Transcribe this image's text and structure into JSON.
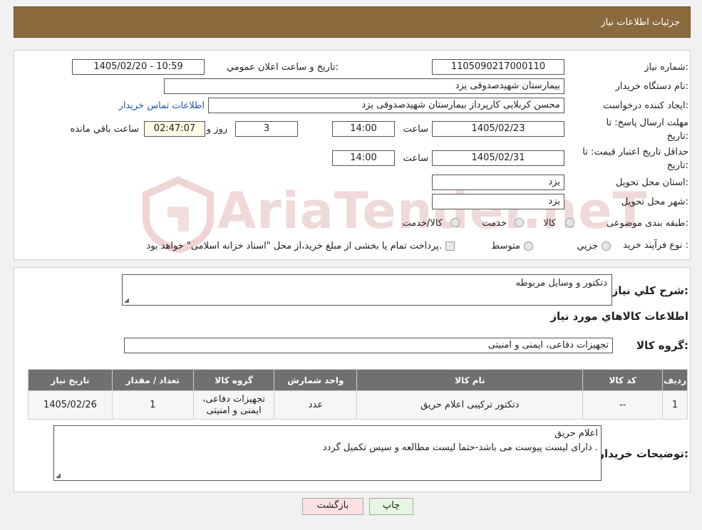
{
  "header": {
    "title": "جزئیات اطلاعات نیاز"
  },
  "watermark": {
    "text": "AriaTender.neT"
  },
  "form": {
    "need_number": {
      "label": "شماره نیاز:",
      "value": "1105090217000110"
    },
    "announce": {
      "label": "تاریخ و ساعت اعلان عمومي:",
      "value": "1405/02/20 - 10:59"
    },
    "buyer": {
      "label": "نام دستگاه خريدار:",
      "value": "بیمارستان شهیدصدوقی یزد"
    },
    "requester": {
      "label": "ايجاد کننده درخواست:",
      "value": "محسن کربلایی کارپرداز بیمارستان شهیدصدوقی یزد",
      "contact_link": "اطلاعات تماس خريدار"
    },
    "deadline": {
      "label_line1": "مهلت ارسال پاسخ: تا",
      "label_line2": "تاريخ:",
      "date": "1405/02/23",
      "time_label": "ساعت",
      "time": "14:00",
      "days": "3",
      "days_label": "روز و",
      "remaining": "02:47:07",
      "remaining_label": "ساعت باقي مانده"
    },
    "validity": {
      "label_line1": "حداقل تاريخ اعتبار قيمت: تا",
      "label_line2": "تاريخ:",
      "date": "1405/02/31",
      "time_label": "ساعت",
      "time": "14:00"
    },
    "province": {
      "label": "استان محل تحويل:",
      "value": "یزد"
    },
    "city": {
      "label": "شهر محل تحويل:",
      "value": "یزد"
    },
    "category": {
      "label": "طبقه بندی موضوعی:",
      "options": [
        "کالا",
        "خدمت",
        "کالا/خدمت"
      ],
      "selected": "کالا"
    },
    "purchase_type": {
      "label": "نوع فرآيند خريد :",
      "options": [
        "جزيي",
        "متوسط"
      ],
      "note": "پرداخت تمام يا بخشی از مبلغ خريد،از محل \"اسناد خزانه اسلامی\" خواهد بود."
    }
  },
  "details": {
    "summary_label": "شرح کلي نياز:",
    "summary_value": "دتکتور و وسایل مربوطه",
    "items_title": "اطلاعات کالاهاي مورد نياز",
    "group_label": "گروه کالا:",
    "group_value": "تجهیزات دفاعی، ایمنی و امنیتی",
    "table": {
      "headers": [
        "رديف",
        "کد کالا",
        "نام کالا",
        "واحد شمارش",
        "گروه کالا",
        "تعداد / مقدار",
        "تاريخ نياز"
      ],
      "rows": [
        {
          "row": "1",
          "code": "--",
          "name": "دتکتور ترکیبی اعلام حریق",
          "unit": "عدد",
          "group_line1": "تجهیزات دفاعی،",
          "group_line2": "ایمنی و امنیتی",
          "qty": "1",
          "date": "1405/02/26"
        }
      ]
    },
    "buyer_notes_label": "توضيحات خريدار:",
    "buyer_notes_line1": "اعلام حریق",
    "buyer_notes_line2": "دارای لیست پیوست می باشد-حتما لیست مطالعه و سپس تکمیل گردد ."
  },
  "buttons": {
    "print": "چاپ",
    "back": "بازگشت"
  },
  "colors": {
    "header_bg": "#8b6a3e",
    "table_header_bg": "#707070",
    "link": "#1e5ab4",
    "back_button_bg": "#fbe1e1",
    "print_button_bg": "#e6f6e1"
  }
}
